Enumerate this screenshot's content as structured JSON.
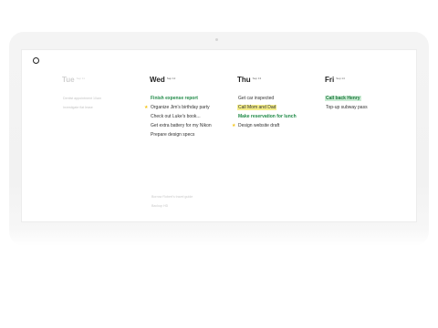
{
  "columns": [
    {
      "day": "Tue",
      "date": "Sep 11",
      "past": true,
      "tasks": [
        {
          "text": "Dentist appointment 10am",
          "style": "done",
          "star": false
        },
        {
          "text": "Investigate flat lease",
          "style": "done",
          "star": false
        }
      ]
    },
    {
      "day": "Wed",
      "date": "Sep 12",
      "past": false,
      "tasks": [
        {
          "text": "Finish expense report",
          "style": "green",
          "star": false
        },
        {
          "text": "Organize Jim's birthday party",
          "style": "plain",
          "star": true
        },
        {
          "text": "Check out Luke's book...",
          "style": "plain",
          "star": false
        },
        {
          "text": "Get extra battery for my Nikon",
          "style": "plain",
          "star": false
        },
        {
          "text": "Prepare design specs",
          "style": "plain",
          "star": false
        }
      ]
    },
    {
      "day": "Thu",
      "date": "Sep 13",
      "past": false,
      "tasks": [
        {
          "text": "Get car inspected",
          "style": "plain",
          "star": false
        },
        {
          "text": "Call Mom and Dad",
          "style": "hl",
          "star": false
        },
        {
          "text": "Make reservation for lunch",
          "style": "green",
          "star": false
        },
        {
          "text": "Design website draft",
          "style": "plain",
          "star": true
        }
      ]
    },
    {
      "day": "Fri",
      "date": "Sep 14",
      "past": false,
      "tasks": [
        {
          "text": "Call back Henry",
          "style": "hl-green",
          "star": false
        },
        {
          "text": "Top-up subway pass",
          "style": "plain",
          "star": false
        }
      ]
    }
  ],
  "someday": [
    {
      "text": "Borrow Robert's travel guide",
      "style": "done"
    },
    {
      "text": "Backup HD",
      "style": "done"
    }
  ],
  "colors": {
    "accent_green": "#1f8a47",
    "highlight_yellow": "#f6ef8a",
    "highlight_green": "#ccecd5",
    "star": "#f5c518"
  },
  "icons": {
    "logo": "circle-logo-icon",
    "star": "star-icon"
  }
}
